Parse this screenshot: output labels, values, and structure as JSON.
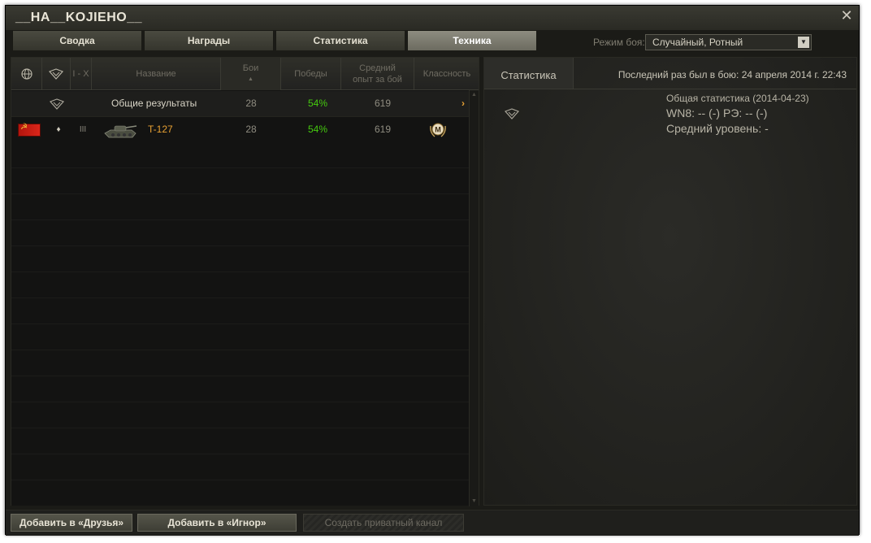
{
  "window": {
    "title": "__HA__KOJIEHO__"
  },
  "tabs": [
    {
      "label": "Сводка"
    },
    {
      "label": "Награды"
    },
    {
      "label": "Статистика"
    },
    {
      "label": "Техника"
    }
  ],
  "battle_mode": {
    "label": "Режим боя:",
    "selected": "Случайный, Ротный"
  },
  "columns": {
    "tier_range": "I - X",
    "name": "Название",
    "battles": "Бои",
    "wins": "Победы",
    "avg_exp_line1": "Средний",
    "avg_exp_line2": "опыт за бой",
    "mastery": "Классность"
  },
  "totals_row": {
    "name": "Общие результаты",
    "battles": "28",
    "wins": "54%",
    "avg_exp": "619",
    "arrow": "›"
  },
  "vehicle_row": {
    "tier": "III",
    "type_glyph": "♦",
    "name": "T-127",
    "battles": "28",
    "wins": "54%",
    "avg_exp": "619",
    "mastery_badge": "M"
  },
  "right_panel": {
    "tab_label": "Статистика",
    "last_battle": "Последний раз был в бою: 24 апреля 2014 г. 22:43",
    "stats_title": "Общая статистика (2014-04-23)",
    "wn8_line": "WN8: -- (-) РЭ: -- (-)",
    "avg_level_line": "Средний уровень: -"
  },
  "buttons": {
    "add_friends": "Добавить в «Друзья»",
    "add_ignore": "Добавить в «Игнор»",
    "private_channel": "Создать приватный канал"
  },
  "colors": {
    "win_pct": "#45c90f",
    "tank_name": "#e8a133",
    "active_tab": "#8d8c80"
  }
}
